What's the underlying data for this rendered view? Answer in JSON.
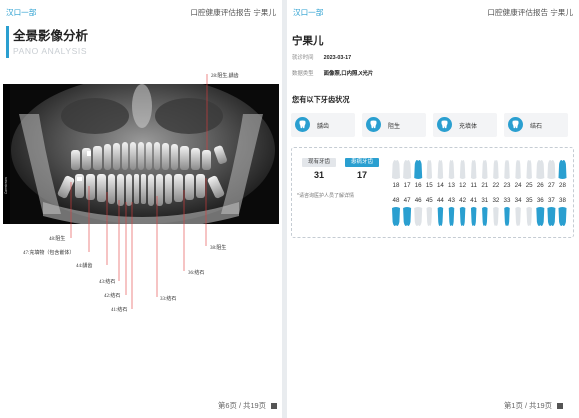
{
  "left_page": {
    "org": "汉口一部",
    "report": "口腔健康评估报告 宁果儿",
    "title": "全景影像分析",
    "subtitle": "PANO ANALYSIS",
    "image_side_label": "Carestream",
    "annotations": {
      "a28": "28:阻生,龋齿",
      "a38": "38:阻生",
      "a36": "36:结石",
      "a33": "33:结石",
      "a48": "48:阻生",
      "a47": "47:充填物（包含嵌体）",
      "a44": "44:龋齿",
      "a43": "43:结石",
      "a42": "42:结石",
      "a41": "41:结石"
    },
    "pager": "第6页 / 共19页"
  },
  "right_page": {
    "org": "汉口一部",
    "report": "口腔健康评估报告 宁果儿",
    "patient_name": "宁果儿",
    "exam_time_label": "就诊时间",
    "exam_time": "2023-03-17",
    "data_type_label": "数据类型",
    "data_type": "面像照,口内照,X光片",
    "section_title": "您有以下牙齿状况",
    "conditions": [
      "龋齿",
      "阻生",
      "充填体",
      "结石"
    ],
    "existing_label": "现有牙齿",
    "existing_count": "31",
    "affected_label": "患病牙齿",
    "affected_count": "17",
    "note": "*请咨询医护人员了解详情",
    "upper_teeth": [
      "18",
      "17",
      "16",
      "15",
      "14",
      "13",
      "12",
      "11",
      "21",
      "22",
      "23",
      "24",
      "25",
      "26",
      "27",
      "28"
    ],
    "lower_teeth": [
      "48",
      "47",
      "46",
      "45",
      "44",
      "43",
      "42",
      "41",
      "31",
      "32",
      "33",
      "34",
      "35",
      "36",
      "37",
      "38"
    ],
    "pager": "第1页 / 共19页"
  },
  "colors": {
    "accent": "#2a9fd0",
    "tooth_affected": "#2a9fd0",
    "tooth_normal": "#dfe3e7",
    "annotation_line": "#e23c3c"
  },
  "affected_upper": [
    "16",
    "28"
  ],
  "affected_lower": [
    "48",
    "47",
    "44",
    "43",
    "42",
    "41",
    "31",
    "33",
    "36",
    "37",
    "38"
  ]
}
